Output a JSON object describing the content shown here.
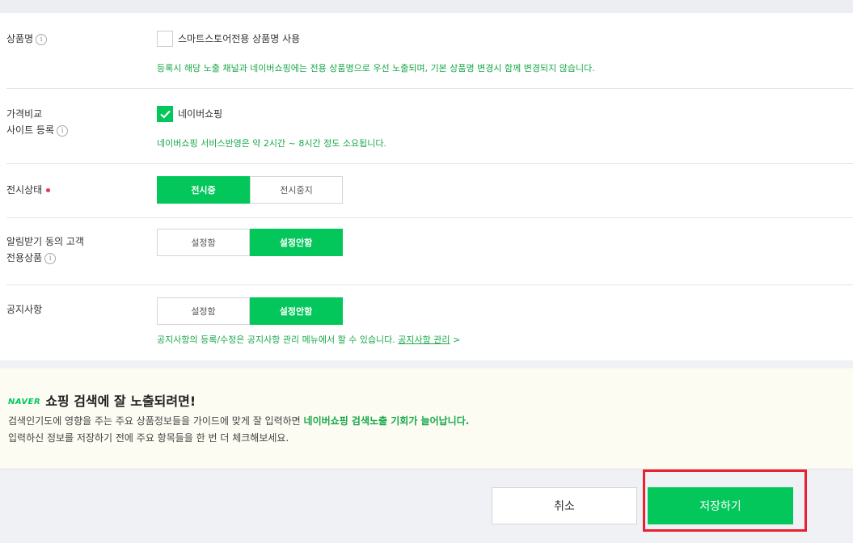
{
  "product_name": {
    "label": "상품명",
    "checkbox_label": "스마트스토어전용 상품명 사용",
    "checked": false,
    "help": "등록시 해당 노출 채널과 네이버쇼핑에는 전용 상품명으로 우선 노출되며, 기본 상품명 변경시 함께 변경되지 않습니다."
  },
  "price_compare": {
    "label_line1": "가격비교",
    "label_line2": "사이트 등록",
    "checkbox_label": "네이버쇼핑",
    "checked": true,
    "help": "네이버쇼핑 서비스반영은 약 2시간 ~ 8시간 정도 소요됩니다."
  },
  "display_status": {
    "label": "전시상태",
    "options": [
      "전시중",
      "전시중지"
    ],
    "selected": "전시중"
  },
  "notify_customer": {
    "label_line1": "알림받기 동의 고객",
    "label_line2": "전용상품",
    "options": [
      "설정함",
      "설정안함"
    ],
    "selected": "설정안함"
  },
  "notice": {
    "label": "공지사항",
    "options": [
      "설정함",
      "설정안함"
    ],
    "selected": "설정안함",
    "help": "공지사항의 등록/수정은 공지사항 관리 메뉴에서 할 수 있습니다.",
    "help_link": "공지사항 관리",
    "help_link_arrow": ">"
  },
  "tip": {
    "logo": "NAVER",
    "title": "쇼핑 검색에 잘 노출되려면!",
    "line1_prefix": "검색인기도에 영향을 주는 주요 상품정보들을 가이드에 맞게 잘 입력하면",
    "line1_highlight": "네이버쇼핑 검색노출 기회가 늘어납니다.",
    "line2": "입력하신 정보를 저장하기 전에 주요 항목들을 한 번 더 체크해보세요."
  },
  "footer": {
    "cancel_label": "취소",
    "save_label": "저장하기"
  },
  "colors": {
    "accent": "#03c75a",
    "help_text": "#19a84a",
    "required_dot": "#e8344e",
    "highlight_box": "#e8202f"
  },
  "icons": {
    "info": "info-circle-icon",
    "check": "checkmark-icon"
  }
}
